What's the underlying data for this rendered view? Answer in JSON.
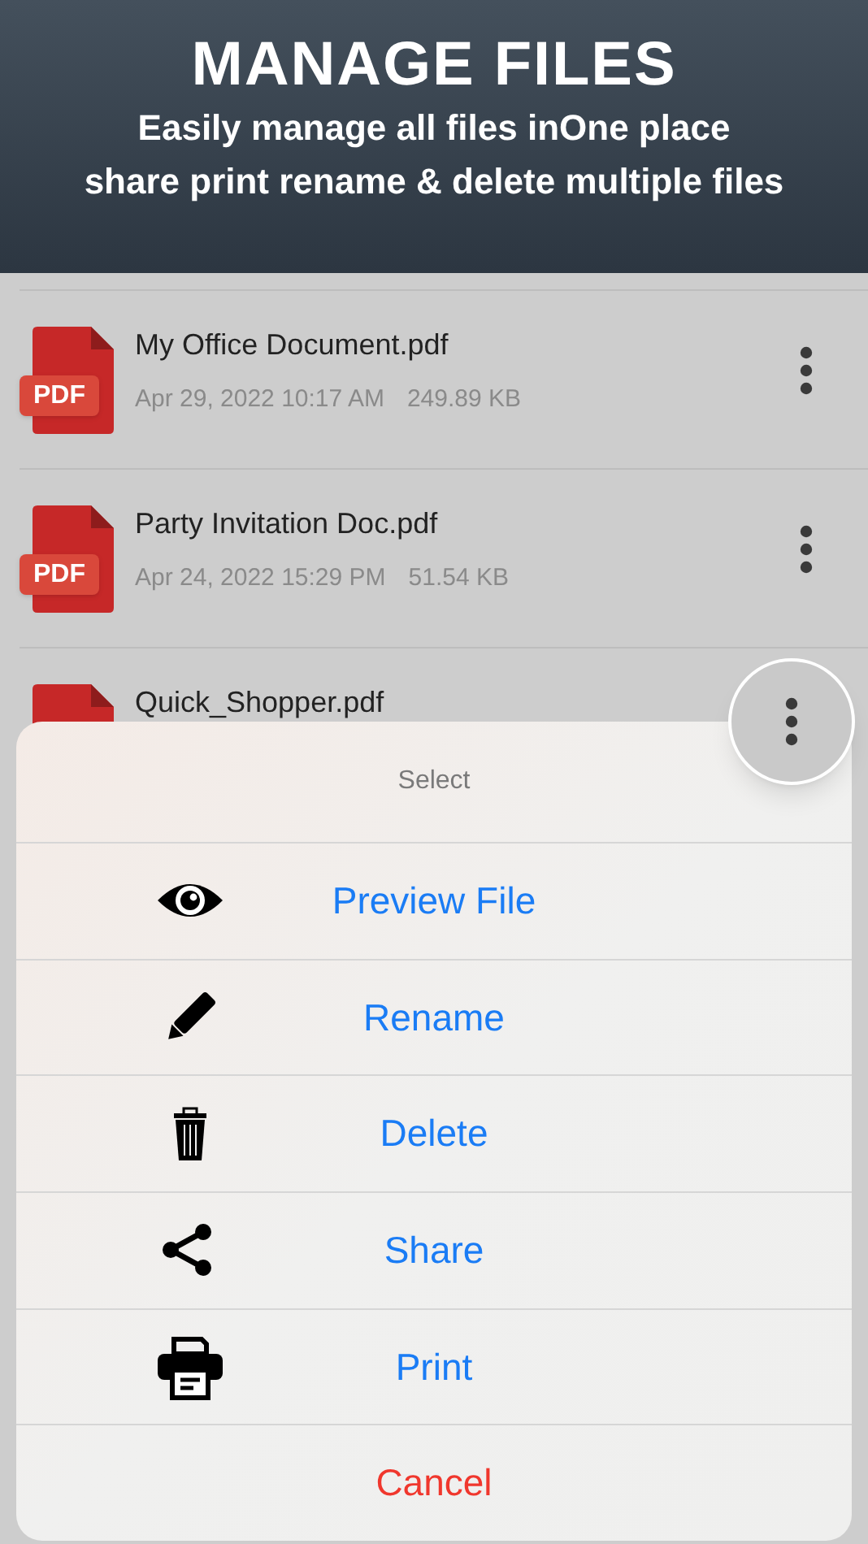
{
  "banner": {
    "title": "MANAGE FILES",
    "subtitle_lines": [
      "Easily manage all files inOne place",
      "share print rename & delete multiple files"
    ]
  },
  "files": [
    {
      "name": "My Office Document.pdf",
      "date": "Apr 29, 2022 10:17 AM",
      "size": "249.89 KB",
      "file_badge": "PDF",
      "highlighted": false
    },
    {
      "name": "Party Invitation Doc.pdf",
      "date": "Apr 24, 2022 15:29 PM",
      "size": "51.54 KB",
      "file_badge": "PDF",
      "highlighted": false
    },
    {
      "name": "Quick_Shopper.pdf",
      "highlighted": true
    }
  ],
  "action_sheet": {
    "title": "Select",
    "items": [
      {
        "label": "Preview File",
        "kind": "preview"
      },
      {
        "label": "Rename",
        "kind": "rename"
      },
      {
        "label": "Delete",
        "kind": "delete"
      },
      {
        "label": "Share",
        "kind": "share"
      },
      {
        "label": "Print",
        "kind": "print"
      },
      {
        "label": "Cancel",
        "kind": "cancel"
      }
    ]
  }
}
